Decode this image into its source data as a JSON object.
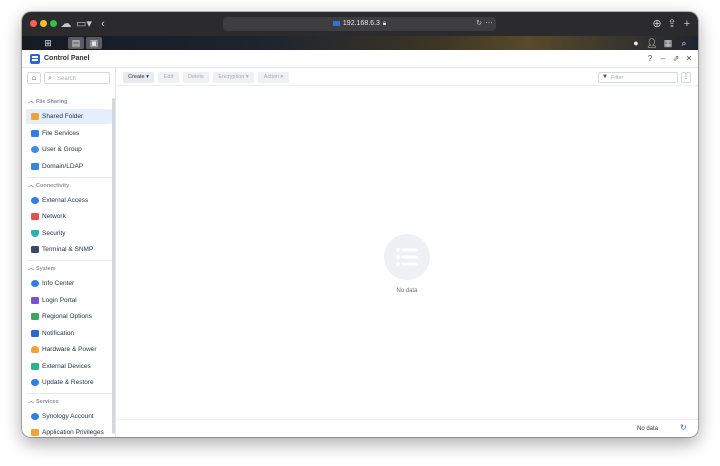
{
  "browser": {
    "url": "192.168.6.3"
  },
  "app": {
    "title": "Control Panel",
    "window_controls": [
      "?",
      "–",
      "⇗",
      "✕"
    ]
  },
  "sidebar": {
    "search_placeholder": "Search",
    "sections": [
      {
        "title": "File Sharing",
        "items": [
          {
            "label": "Shared Folder",
            "icon": "folder-icon",
            "color": "#f0a33a",
            "active": true
          },
          {
            "label": "File Services",
            "icon": "file-services-icon",
            "color": "#2f7fe0"
          },
          {
            "label": "User & Group",
            "icon": "user-group-icon",
            "color": "#3b8fe6"
          },
          {
            "label": "Domain/LDAP",
            "icon": "domain-icon",
            "color": "#3c83e0"
          }
        ]
      },
      {
        "title": "Connectivity",
        "items": [
          {
            "label": "External Access",
            "icon": "external-access-icon",
            "color": "#2f7fe0"
          },
          {
            "label": "Network",
            "icon": "network-home-icon",
            "color": "#e05252"
          },
          {
            "label": "Security",
            "icon": "shield-icon",
            "color": "#2bb3b1"
          },
          {
            "label": "Terminal & SNMP",
            "icon": "terminal-icon",
            "color": "#3a4a66"
          }
        ]
      },
      {
        "title": "System",
        "items": [
          {
            "label": "Info Center",
            "icon": "info-icon",
            "color": "#2f7fe0"
          },
          {
            "label": "Login Portal",
            "icon": "login-portal-icon",
            "color": "#7a4fd0"
          },
          {
            "label": "Regional Options",
            "icon": "globe-icon",
            "color": "#3aa860"
          },
          {
            "label": "Notification",
            "icon": "notification-icon",
            "color": "#2f67c9"
          },
          {
            "label": "Hardware & Power",
            "icon": "bulb-icon",
            "color": "#f0a33a"
          },
          {
            "label": "External Devices",
            "icon": "external-devices-icon",
            "color": "#2bb38a"
          },
          {
            "label": "Update & Restore",
            "icon": "update-icon",
            "color": "#2f7fe0"
          }
        ]
      },
      {
        "title": "Services",
        "items": [
          {
            "label": "Synology Account",
            "icon": "synology-account-icon",
            "color": "#2f7fe0"
          },
          {
            "label": "Application Privileges",
            "icon": "lock-icon",
            "color": "#f0a33a"
          }
        ]
      }
    ]
  },
  "toolbar": {
    "buttons": [
      {
        "label": "Create ▾",
        "enabled": true
      },
      {
        "label": "Edit",
        "enabled": false
      },
      {
        "label": "Delete",
        "enabled": false
      },
      {
        "label": "Encryption ▾",
        "enabled": false
      },
      {
        "label": "Action ▾",
        "enabled": false
      }
    ],
    "filter_placeholder": "Filter"
  },
  "main": {
    "empty_text": "No data"
  },
  "footer": {
    "status": "No data"
  }
}
